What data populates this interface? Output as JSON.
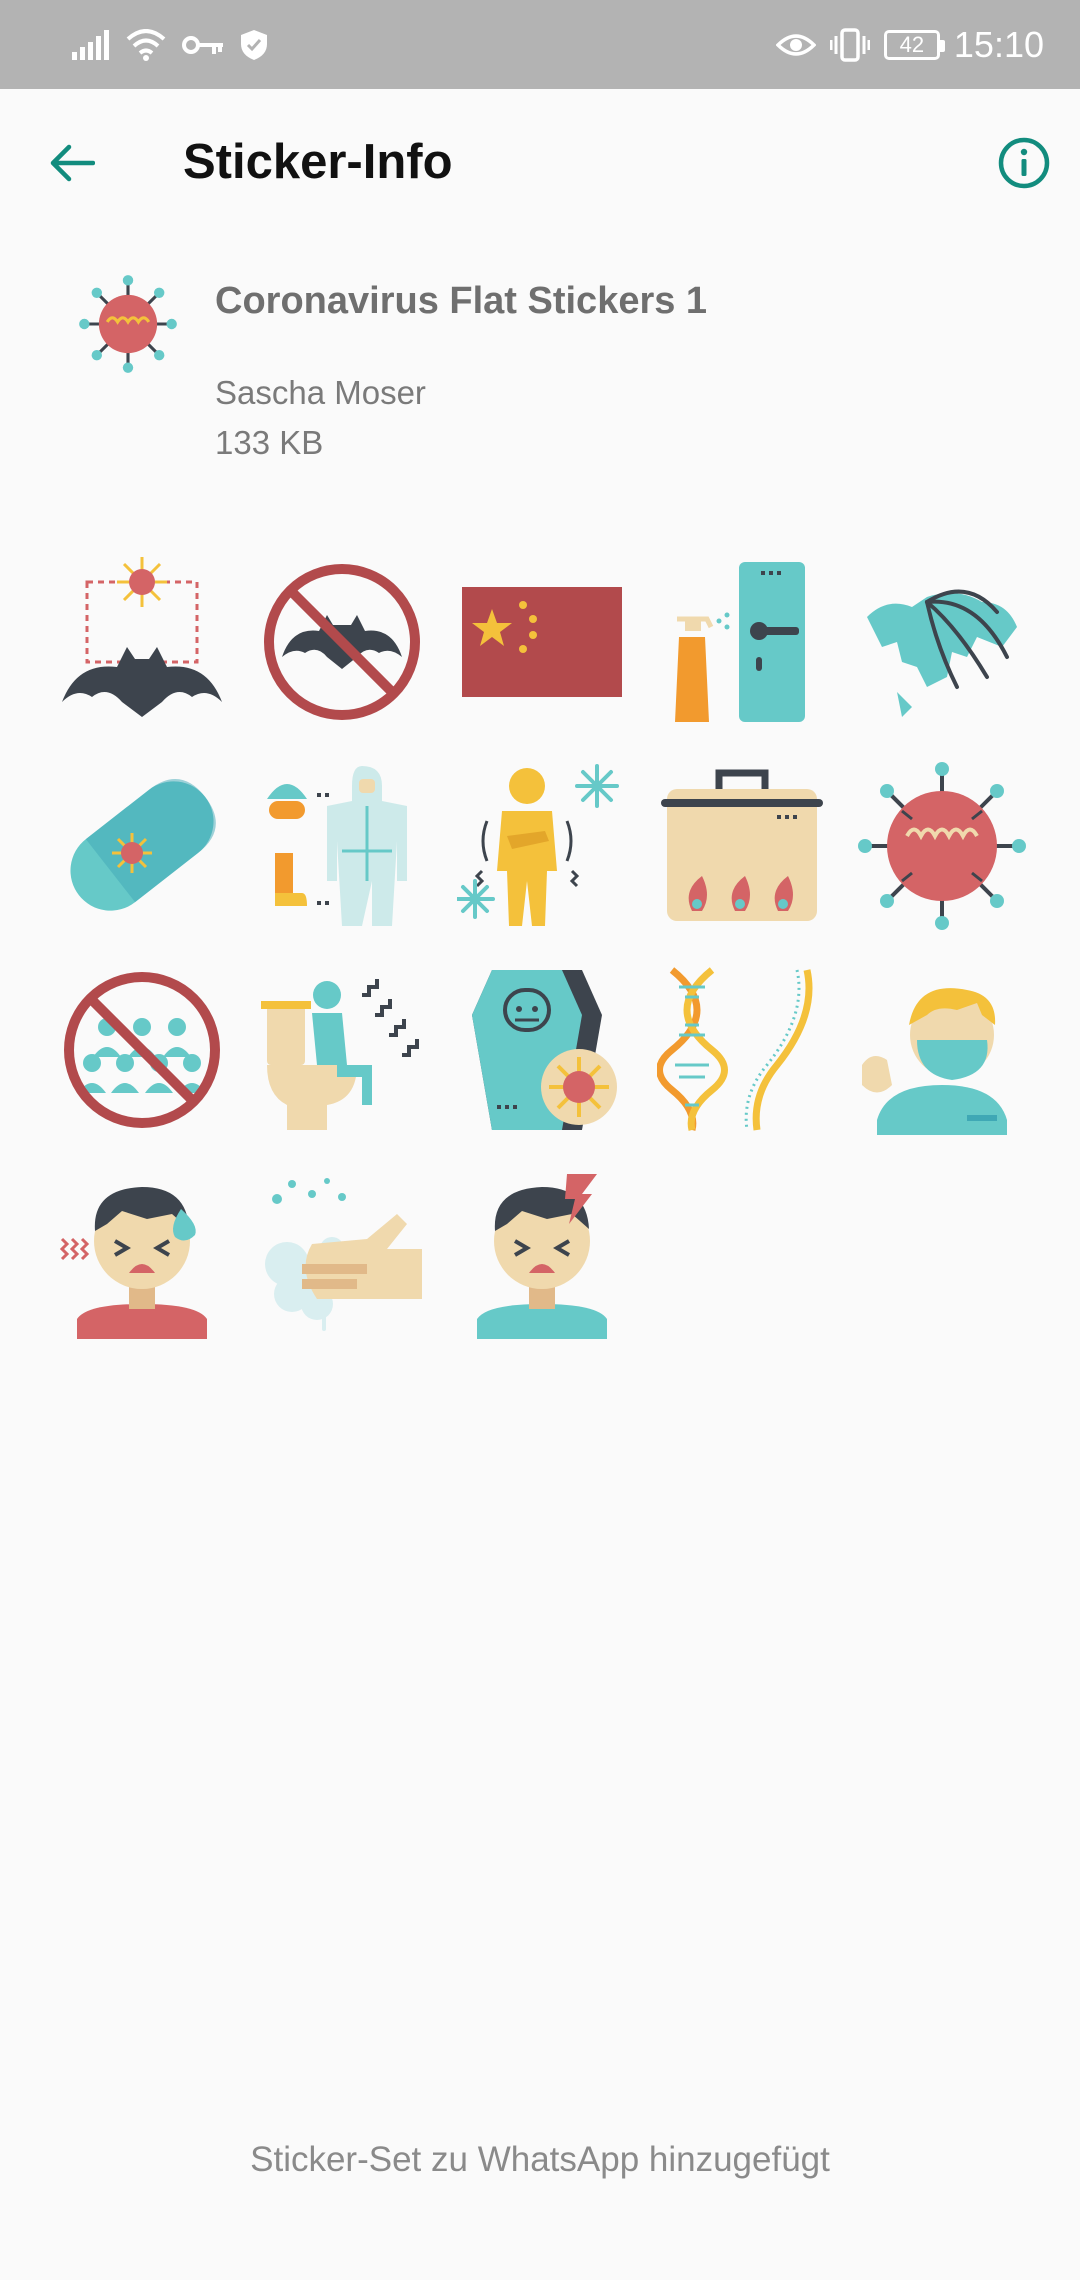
{
  "status_bar": {
    "time": "15:10",
    "battery": "42"
  },
  "app_bar": {
    "title": "Sticker-Info"
  },
  "pack": {
    "name": "Coronavirus Flat Stickers 1",
    "author": "Sascha Moser",
    "size": "133 KB"
  },
  "stickers": [
    "bat-virus-sticker",
    "no-bats-sticker",
    "china-flag-sticker",
    "disinfect-door-sticker",
    "world-map-spread-sticker",
    "virus-pill-sticker",
    "protective-suit-sticker",
    "fever-chills-sticker",
    "cooking-pot-sticker",
    "coronavirus-sticker",
    "no-crowds-sticker",
    "sick-toilet-sticker",
    "coffin-sticker",
    "dna-sticker",
    "mask-man-sticker",
    "sweating-man-sticker",
    "wash-hands-sticker",
    "headache-man-sticker"
  ],
  "footer": {
    "status": "Sticker-Set zu WhatsApp hinzugefügt"
  },
  "colors": {
    "accent": "#128c7e",
    "virus_red": "#d46466",
    "teal": "#66c9c8",
    "dark": "#3d444d",
    "yellow": "#f4c13b"
  }
}
